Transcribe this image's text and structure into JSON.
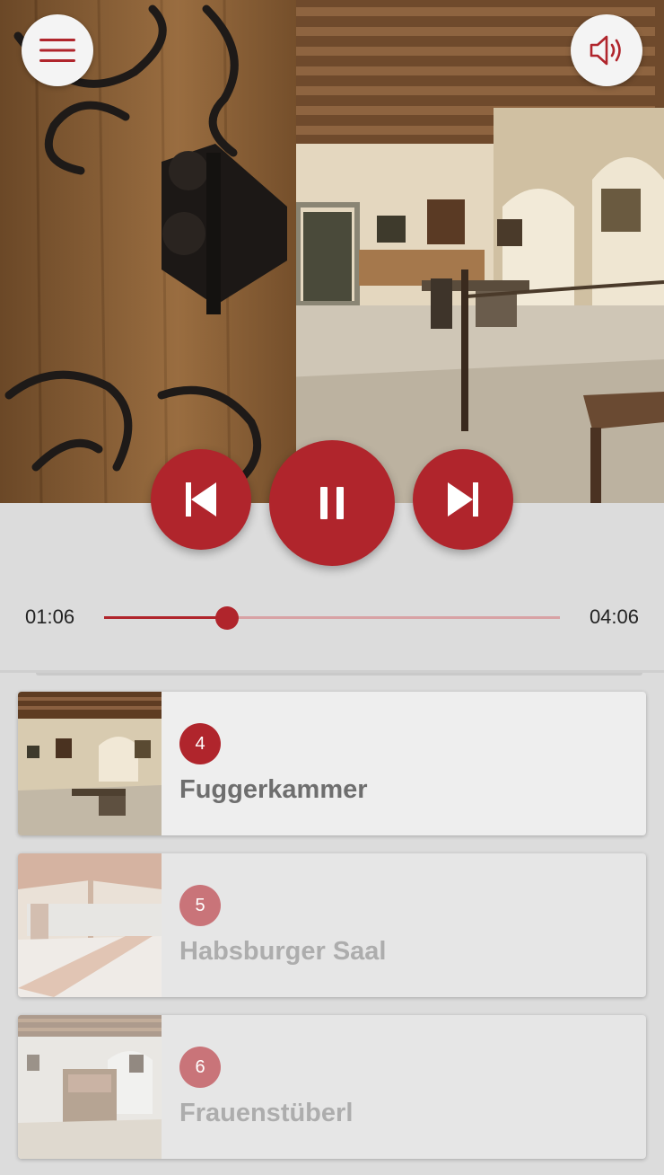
{
  "header": {
    "menu_icon": "hamburger-icon",
    "sound_icon": "speaker-icon"
  },
  "player": {
    "current_time": "01:06",
    "total_time": "04:06",
    "progress": 0.27,
    "prev_icon": "skip-previous-icon",
    "play_icon": "pause-icon",
    "next_icon": "skip-next-icon"
  },
  "stations": [
    {
      "number": "4",
      "title": "Fuggerkammer",
      "active": true
    },
    {
      "number": "5",
      "title": "Habsburger Saal",
      "active": false
    },
    {
      "number": "6",
      "title": "Frauenstüberl",
      "active": false
    }
  ],
  "colors": {
    "accent": "#b0252c",
    "accent_dim": "#c97479"
  }
}
